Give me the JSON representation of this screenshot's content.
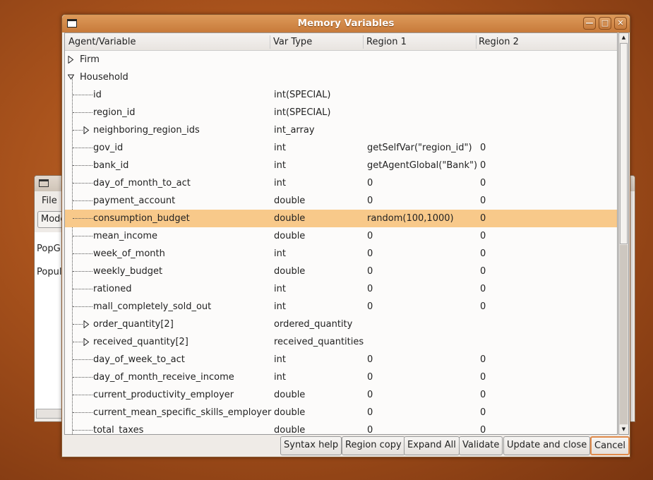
{
  "background_window": {
    "menu_file": "File",
    "mode_button": "Mode",
    "labels": [
      "PopG",
      "Popul"
    ]
  },
  "dialog": {
    "title": "Memory Variables",
    "columns": [
      "Agent/Variable",
      "Var Type",
      "Region 1",
      "Region 2"
    ],
    "rows": [
      {
        "name": "Firm",
        "type": "",
        "r1": "",
        "r2": "",
        "level": 0,
        "expander": "collapsed"
      },
      {
        "name": "Household",
        "type": "",
        "r1": "",
        "r2": "",
        "level": 0,
        "expander": "expanded"
      },
      {
        "name": "id",
        "type": "int(SPECIAL)",
        "r1": "",
        "r2": "",
        "level": 1
      },
      {
        "name": "region_id",
        "type": "int(SPECIAL)",
        "r1": "",
        "r2": "",
        "level": 1
      },
      {
        "name": "neighboring_region_ids",
        "type": "int_array",
        "r1": "",
        "r2": "",
        "level": 1,
        "expander": "collapsed"
      },
      {
        "name": "gov_id",
        "type": "int",
        "r1": "getSelfVar(\"region_id\")",
        "r2": "0",
        "level": 1
      },
      {
        "name": "bank_id",
        "type": "int",
        "r1": "getAgentGlobal(\"Bank\")",
        "r2": "0",
        "level": 1
      },
      {
        "name": "day_of_month_to_act",
        "type": "int",
        "r1": "0",
        "r2": "0",
        "level": 1
      },
      {
        "name": "payment_account",
        "type": "double",
        "r1": "0",
        "r2": "0",
        "level": 1
      },
      {
        "name": "consumption_budget",
        "type": "double",
        "r1": "random(100,1000)",
        "r2": "0",
        "level": 1,
        "selected": true
      },
      {
        "name": "mean_income",
        "type": "double",
        "r1": "0",
        "r2": "0",
        "level": 1
      },
      {
        "name": "week_of_month",
        "type": "int",
        "r1": "0",
        "r2": "0",
        "level": 1
      },
      {
        "name": "weekly_budget",
        "type": "double",
        "r1": "0",
        "r2": "0",
        "level": 1
      },
      {
        "name": "rationed",
        "type": "int",
        "r1": "0",
        "r2": "0",
        "level": 1
      },
      {
        "name": "mall_completely_sold_out",
        "type": "int",
        "r1": "0",
        "r2": "0",
        "level": 1
      },
      {
        "name": "order_quantity[2]",
        "type": "ordered_quantity",
        "r1": "",
        "r2": "",
        "level": 1,
        "expander": "collapsed"
      },
      {
        "name": "received_quantity[2]",
        "type": "received_quantities",
        "r1": "",
        "r2": "",
        "level": 1,
        "expander": "collapsed"
      },
      {
        "name": "day_of_week_to_act",
        "type": "int",
        "r1": "0",
        "r2": "0",
        "level": 1
      },
      {
        "name": "day_of_month_receive_income",
        "type": "int",
        "r1": "0",
        "r2": "0",
        "level": 1
      },
      {
        "name": "current_productivity_employer",
        "type": "double",
        "r1": "0",
        "r2": "0",
        "level": 1
      },
      {
        "name": "current_mean_specific_skills_employer",
        "type": "double",
        "r1": "0",
        "r2": "0",
        "level": 1
      },
      {
        "name": "total_taxes",
        "type": "double",
        "r1": "0",
        "r2": "0",
        "level": 1
      }
    ],
    "buttons": [
      "Syntax help",
      "Region copy",
      "Expand All",
      "Validate",
      "Update and close",
      "Cancel"
    ],
    "scroll_position": 0.0,
    "colors": {
      "selection": "#f8c98a",
      "titlebar": "#d08a4a"
    }
  }
}
